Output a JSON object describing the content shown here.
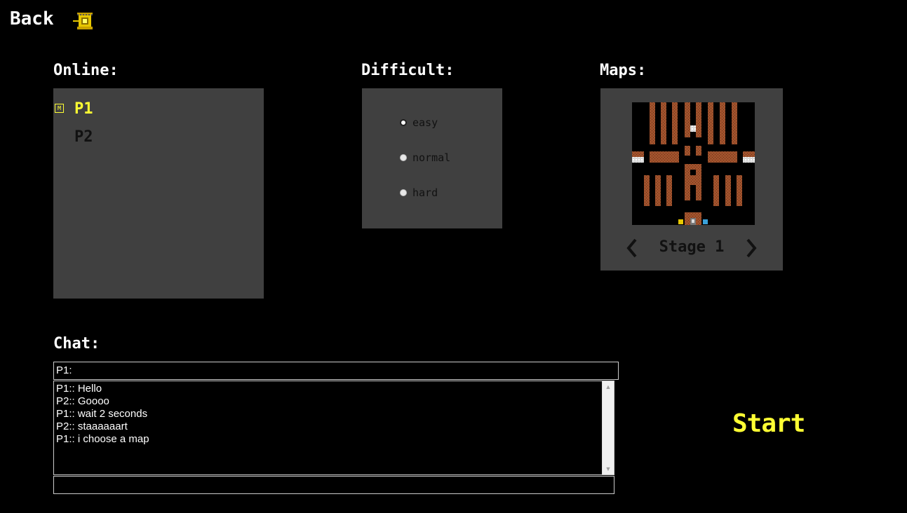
{
  "header": {
    "back_label": "Back",
    "icon": "tank-icon"
  },
  "online": {
    "label": "Online:",
    "host_badge": "M",
    "players": [
      {
        "name": "P1",
        "color": "#ffff33",
        "is_host": true
      },
      {
        "name": "P2",
        "color": "#111111",
        "is_host": false
      }
    ]
  },
  "difficulty": {
    "label": "Difficult:",
    "options": [
      {
        "label": "easy",
        "selected": true
      },
      {
        "label": "normal",
        "selected": false
      },
      {
        "label": "hard",
        "selected": false
      }
    ]
  },
  "maps": {
    "label": "Maps:",
    "current_stage": "Stage 1",
    "prev_icon": "chevron-left-icon",
    "next_icon": "chevron-right-icon"
  },
  "chat": {
    "label": "Chat:",
    "top_field_value": "P1:",
    "messages": [
      "P1:: Hello",
      "P2:: Goooo",
      "P1:: wait 2 seconds",
      "P2:: staaaaaart",
      "P1:: i choose a map"
    ],
    "input_value": ""
  },
  "start_label": "Start",
  "colors": {
    "accent": "#ffff33",
    "panel": "#404040",
    "brick": "#a0522d",
    "background": "#000000"
  }
}
